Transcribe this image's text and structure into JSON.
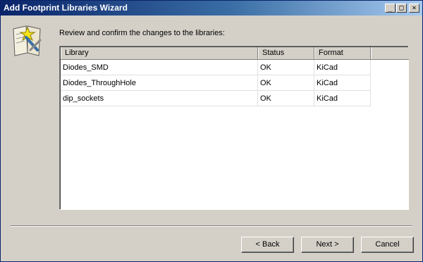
{
  "window": {
    "title": "Add Footprint Libraries Wizard",
    "controls": {
      "minimize": "_",
      "maximize": "□",
      "close": "×"
    }
  },
  "icon": {
    "name": "wizard-icon"
  },
  "main": {
    "heading": "Review and confirm the changes to the libraries:",
    "table": {
      "columns": [
        "Library",
        "Status",
        "Format"
      ],
      "rows": [
        {
          "library": "Diodes_SMD",
          "status": "OK",
          "format": "KiCad"
        },
        {
          "library": "Diodes_ThroughHole",
          "status": "OK",
          "format": "KiCad"
        },
        {
          "library": "dip_sockets",
          "status": "OK",
          "format": "KiCad"
        }
      ]
    }
  },
  "buttons": {
    "back": "< Back",
    "next": "Next >",
    "cancel": "Cancel"
  }
}
